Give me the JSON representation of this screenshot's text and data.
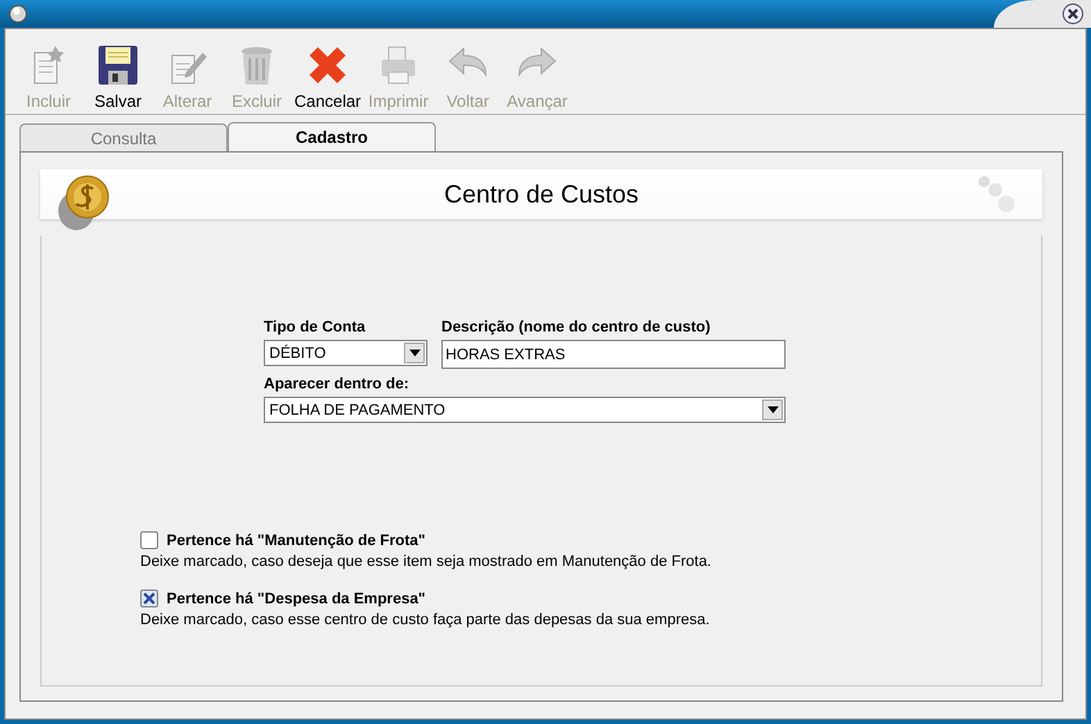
{
  "toolbar": [
    {
      "kind": "new",
      "label": "Incluir",
      "disabled": true
    },
    {
      "kind": "save",
      "label": "Salvar",
      "disabled": false
    },
    {
      "kind": "edit",
      "label": "Alterar",
      "disabled": true
    },
    {
      "kind": "delete",
      "label": "Excluir",
      "disabled": true
    },
    {
      "kind": "cancel",
      "label": "Cancelar",
      "disabled": false
    },
    {
      "kind": "print",
      "label": "Imprimir",
      "disabled": true
    },
    {
      "kind": "back",
      "label": "Voltar",
      "disabled": true
    },
    {
      "kind": "forward",
      "label": "Avançar",
      "disabled": true
    }
  ],
  "tabs": [
    {
      "label": "Consulta",
      "selected": false
    },
    {
      "label": "Cadastro",
      "selected": true
    }
  ],
  "header": {
    "title": "Centro de Custos"
  },
  "form": {
    "account_type": {
      "label": "Tipo de Conta",
      "value": "DÉBITO"
    },
    "description": {
      "label": "Descrição (nome do centro de custo)",
      "value": "HORAS EXTRAS"
    },
    "parent": {
      "label": "Aparecer dentro de:",
      "value": "FOLHA DE PAGAMENTO"
    }
  },
  "options": [
    {
      "label": "Pertence há \"Manutenção de Frota\"",
      "checked": false,
      "hint": "Deixe marcado, caso deseja que esse item seja mostrado em Manutenção de Frota."
    },
    {
      "label": "Pertence há \"Despesa da Empresa\"",
      "checked": true,
      "hint": "Deixe marcado, caso esse centro de custo faça parte das depesas da sua empresa."
    }
  ]
}
